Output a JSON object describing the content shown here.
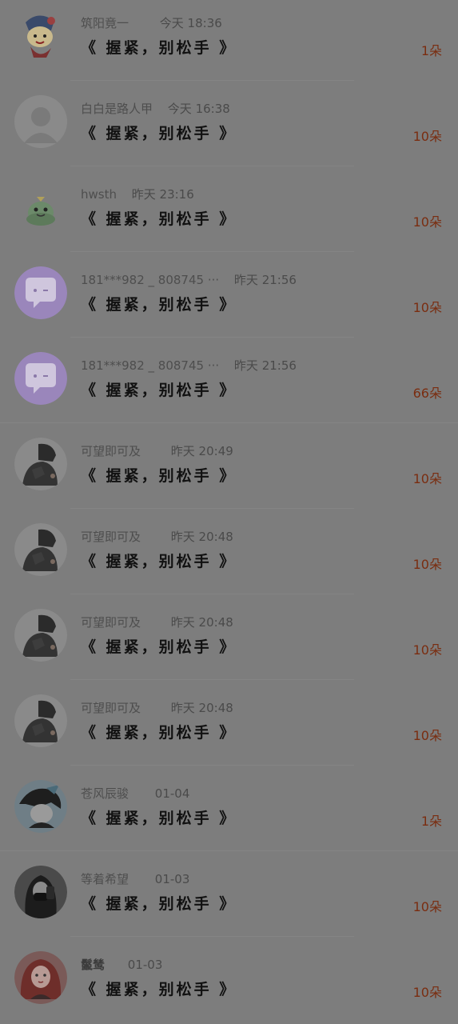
{
  "gift_list": {
    "items": [
      {
        "name": "筑阳竟一",
        "time": "今天 18:36",
        "gift": "《 握紧，别松手 》",
        "count": "1朵",
        "avatar": "cartoon-kid-avatar"
      },
      {
        "name": "白白是路人甲",
        "time": "今天 16:38",
        "gift": "《 握紧，别松手 》",
        "count": "10朵",
        "avatar": "default-person-avatar"
      },
      {
        "name": "hwsth",
        "time": "昨天 23:16",
        "gift": "《 握紧，别松手 》",
        "count": "10朵",
        "avatar": "green-frog-avatar"
      },
      {
        "name": "181***982 _ 808745 ···",
        "time": "昨天 21:56",
        "gift": "《 握紧，别松手 》",
        "count": "10朵",
        "avatar": "purple-chat-avatar"
      },
      {
        "name": "181***982 _ 808745 ···",
        "time": "昨天 21:56",
        "gift": "《 握紧，别松手 》",
        "count": "66朵",
        "avatar": "purple-chat-avatar"
      },
      {
        "name": "可望即可及",
        "time": "昨天 20:49",
        "gift": "《 握紧，别松手 》",
        "count": "10朵",
        "avatar": "helmet-rider-avatar"
      },
      {
        "name": "可望即可及",
        "time": "昨天 20:48",
        "gift": "《 握紧，别松手 》",
        "count": "10朵",
        "avatar": "helmet-rider-avatar"
      },
      {
        "name": "可望即可及",
        "time": "昨天 20:48",
        "gift": "《 握紧，别松手 》",
        "count": "10朵",
        "avatar": "helmet-rider-avatar"
      },
      {
        "name": "可望即可及",
        "time": "昨天 20:48",
        "gift": "《 握紧，别松手 》",
        "count": "10朵",
        "avatar": "helmet-rider-avatar"
      },
      {
        "name": "苍风辰骏",
        "time": "01-04",
        "gift": "《 握紧，别松手 》",
        "count": "1朵",
        "avatar": "anime-boy-avatar"
      },
      {
        "name": "等着希望",
        "time": "01-03",
        "gift": "《 握紧，别松手 》",
        "count": "10朵",
        "avatar": "masked-girl-avatar"
      },
      {
        "name": "鬣鸶",
        "time": "01-03",
        "gift": "《 握紧，别松手 》",
        "count": "10朵",
        "avatar": "red-hair-girl-avatar"
      }
    ]
  },
  "colors": {
    "overlay_background": "#7d7d7d",
    "count_accent": "#7a2d10",
    "purple_avatar": "#9a86bb"
  }
}
